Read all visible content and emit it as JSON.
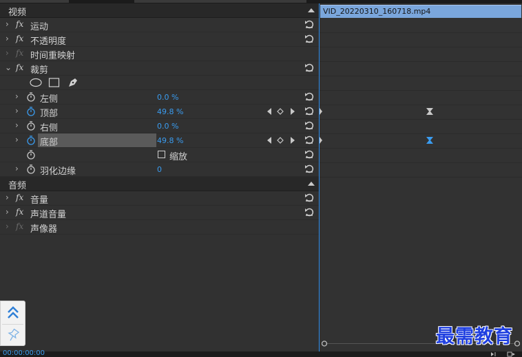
{
  "left_panel": {
    "video_section": {
      "title": "视频"
    },
    "effects": [
      {
        "label": "运动",
        "fx_dim": false
      },
      {
        "label": "不透明度",
        "fx_dim": false
      },
      {
        "label": "时间重映射",
        "fx_dim": true
      },
      {
        "label": "裁剪",
        "fx_dim": false,
        "expanded": true
      }
    ],
    "crop_params": [
      {
        "label": "左侧",
        "value": "0.0 %"
      },
      {
        "label": "顶部",
        "value": "49.8 %"
      },
      {
        "label": "右侧",
        "value": "0.0 %"
      },
      {
        "label": "底部",
        "value": "49.8 %"
      }
    ],
    "zoom_checkbox": {
      "label": "缩放",
      "checked": false
    },
    "feather": {
      "label": "羽化边缘",
      "value": "0"
    },
    "audio_section": {
      "title": "音频"
    },
    "audio_effects": [
      {
        "label": "音量",
        "fx_dim": false
      },
      {
        "label": "声道音量",
        "fx_dim": false
      },
      {
        "label": "声像器",
        "fx_dim": true
      }
    ]
  },
  "timeline": {
    "clip_name": "VID_20220310_160718.mp4",
    "playhead_color": "#2d8ceb",
    "clip_color": "#7aa6dc"
  },
  "bottom_bar": {
    "timecode": "00:00:00:00"
  },
  "watermark": {
    "text": "最需教育"
  },
  "colors": {
    "accent": "#3a9cf0",
    "panel_bg": "#313131",
    "header_bg": "#282828"
  },
  "icons": {
    "reset": "reset-icon",
    "stopwatch": "stopwatch-icon",
    "ellipse_mask": "ellipse-mask-icon",
    "rect_mask": "rectangle-mask-icon",
    "pen_mask": "pen-mask-icon",
    "pin": "pin-icon",
    "collapse": "double-chevron-up-icon"
  }
}
